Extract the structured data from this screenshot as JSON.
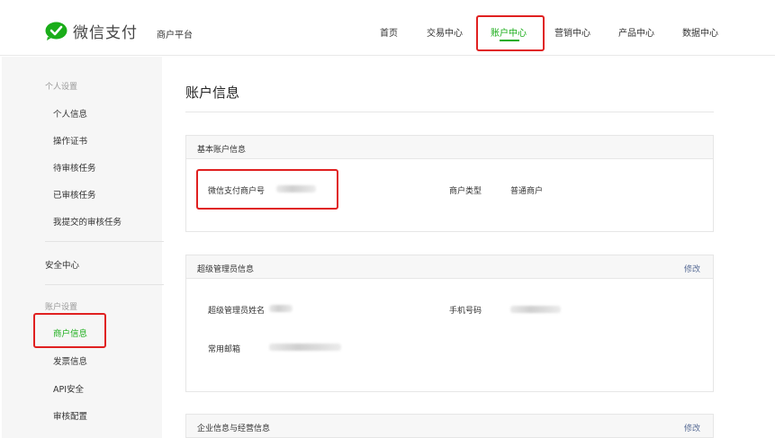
{
  "header": {
    "logo_text": "微信支付",
    "platform": "商户平台",
    "nav": [
      {
        "label": "首页",
        "active": false
      },
      {
        "label": "交易中心",
        "active": false
      },
      {
        "label": "账户中心",
        "active": true
      },
      {
        "label": "营销中心",
        "active": false
      },
      {
        "label": "产品中心",
        "active": false
      },
      {
        "label": "数据中心",
        "active": false
      }
    ]
  },
  "sidebar": {
    "group_personal": "个人设置",
    "personal_items": [
      "个人信息",
      "操作证书",
      "待审核任务",
      "已审核任务",
      "我提交的审核任务"
    ],
    "security": "安全中心",
    "group_account": "账户设置",
    "account_items": [
      "商户信息",
      "发票信息",
      "API安全",
      "审核配置"
    ]
  },
  "main": {
    "title": "账户信息",
    "basic_card": {
      "title": "基本账户信息",
      "merchant_id_label": "微信支付商户号",
      "merchant_type_label": "商户类型",
      "merchant_type_value": "普通商户"
    },
    "admin_card": {
      "title": "超级管理员信息",
      "edit_label": "修改",
      "name_label": "超级管理员姓名",
      "phone_label": "手机号码",
      "email_label": "常用邮箱"
    },
    "enterprise_card": {
      "title": "企业信息与经营信息",
      "edit_label": "修改"
    }
  },
  "colors": {
    "accent": "#1aad19",
    "link": "#576b95",
    "highlight": "#e02020"
  },
  "icons": {
    "logo": "wechat-pay-check-bubble-icon"
  }
}
